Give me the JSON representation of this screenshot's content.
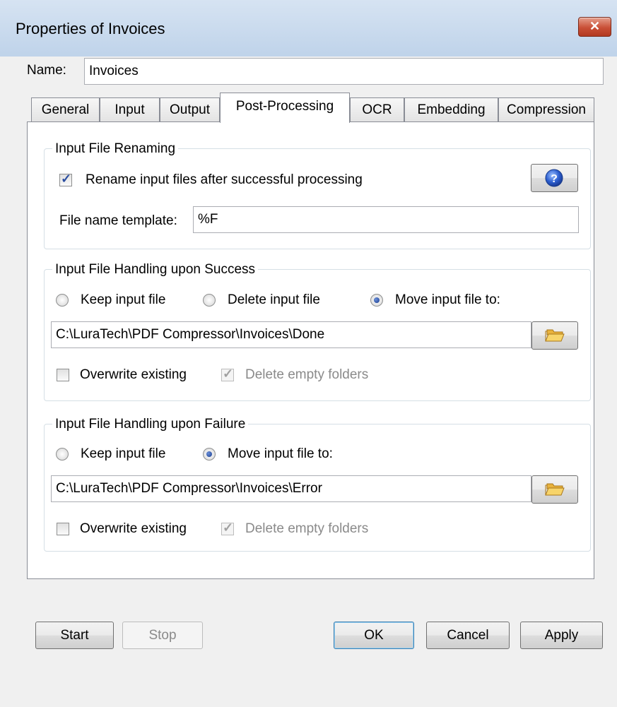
{
  "window": {
    "title": "Properties of Invoices",
    "close_glyph": "✕"
  },
  "name_field": {
    "label": "Name:",
    "value": "Invoices"
  },
  "tabs": [
    {
      "label": "General"
    },
    {
      "label": "Input"
    },
    {
      "label": "Output"
    },
    {
      "label": "Post-Processing"
    },
    {
      "label": "OCR"
    },
    {
      "label": "Embedding"
    },
    {
      "label": "Compression"
    }
  ],
  "active_tab": "Post-Processing",
  "renaming": {
    "title": "Input File Renaming",
    "rename_checkbox": {
      "label": "Rename input files after successful processing",
      "checked": true
    },
    "template_label": "File name template:",
    "template_value": "%F",
    "help_icon": "help-icon"
  },
  "success": {
    "title": "Input File Handling upon Success",
    "options": [
      "Keep input file",
      "Delete input file",
      "Move input file to:"
    ],
    "selected": "Move input file to:",
    "path": "C:\\LuraTech\\PDF Compressor\\Invoices\\Done",
    "overwrite": {
      "label": "Overwrite existing",
      "checked": false
    },
    "delete_empty": {
      "label": "Delete empty folders",
      "checked": true,
      "disabled": true
    }
  },
  "failure": {
    "title": "Input File Handling upon Failure",
    "options": [
      "Keep input file",
      "Move input file to:"
    ],
    "selected": "Move input file to:",
    "path": "C:\\LuraTech\\PDF Compressor\\Invoices\\Error",
    "overwrite": {
      "label": "Overwrite existing",
      "checked": false
    },
    "delete_empty": {
      "label": "Delete empty folders",
      "checked": true,
      "disabled": true
    }
  },
  "buttons": {
    "start": "Start",
    "stop": "Stop",
    "ok": "OK",
    "cancel": "Cancel",
    "apply": "Apply"
  },
  "colors": {
    "titlebar": "#c4d6ec",
    "close": "#c94f36",
    "accent": "#2a4da0"
  }
}
